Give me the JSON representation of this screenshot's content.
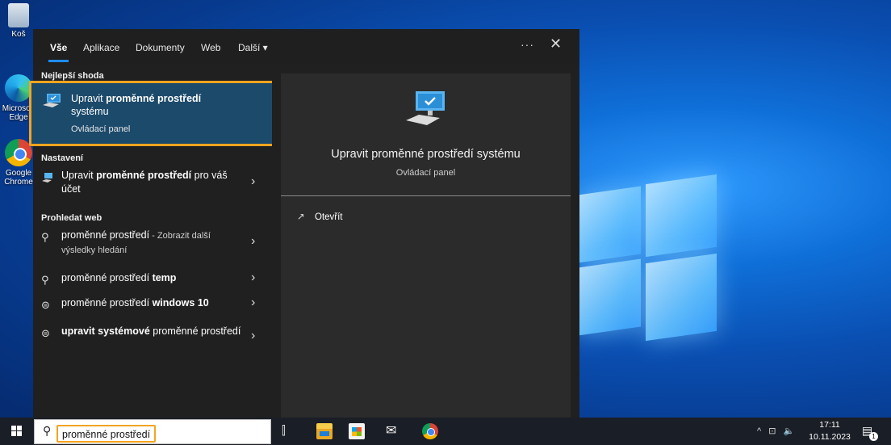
{
  "desktop": {
    "icons": [
      {
        "label": "Koš"
      },
      {
        "label": "Microsoft Edge"
      },
      {
        "label": "Google Chrome"
      }
    ]
  },
  "search_panel": {
    "tabs": [
      {
        "label": "Vše",
        "active": true
      },
      {
        "label": "Aplikace"
      },
      {
        "label": "Dokumenty"
      },
      {
        "label": "Web"
      },
      {
        "label": "Další ▾"
      }
    ],
    "more_options": "···",
    "close": "✕",
    "best_match": {
      "header": "Nejlepší shoda",
      "title_pre": "Upravit ",
      "title_bold": "proměnné prostředí",
      "title_post": " systému",
      "subtitle": "Ovládací panel"
    },
    "settings": {
      "header": "Nastavení",
      "item_pre": "Upravit ",
      "item_bold": "proměnné prostředí",
      "item_post": " pro váš účet"
    },
    "web": {
      "header": "Prohledat web",
      "items": [
        {
          "pre": "proměnné prostředí",
          "bold": "",
          "note": " - Zobrazit další výsledky hledání"
        },
        {
          "pre": "proměnné prostředí ",
          "bold": "temp",
          "note": ""
        },
        {
          "pre": "proměnné prostředí ",
          "bold": "windows 10",
          "note": ""
        },
        {
          "bold": "upravit systémové",
          "pre": " proměnné prostředí",
          "note": ""
        }
      ]
    },
    "preview": {
      "title": "Upravit proměnné prostředí systému",
      "subtitle": "Ovládací panel",
      "action": "Otevřít"
    }
  },
  "taskbar": {
    "search_value": "proměnné prostředí",
    "time": "17:11",
    "date": "10.11.2023",
    "notification_count": "1",
    "tray": [
      "^",
      "⊡",
      "🔈"
    ]
  }
}
